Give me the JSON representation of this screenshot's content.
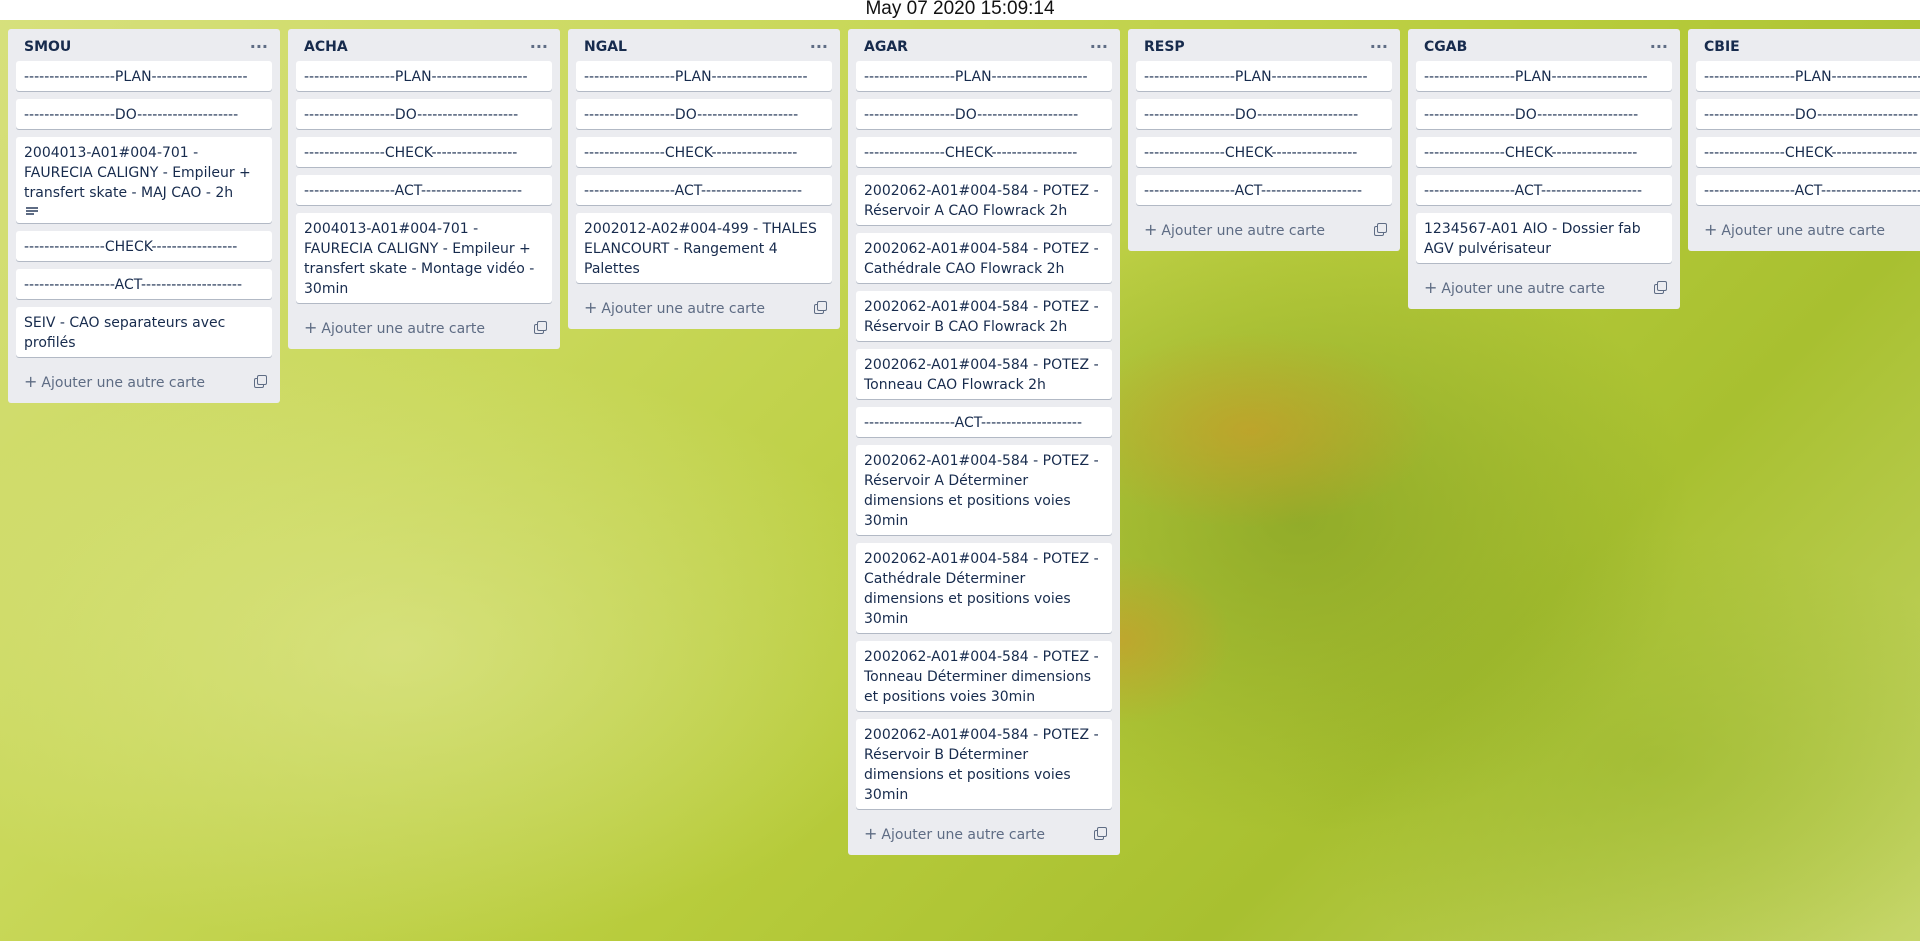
{
  "clock": "May 07 2020 15:09:14",
  "add_card_label": "Ajouter une autre carte",
  "lists": [
    {
      "title": "SMOU",
      "cards": [
        "------------------PLAN-------------------",
        "------------------DO--------------------",
        "2004013-A01#004-701 - FAURECIA CALIGNY - Empileur + transfert skate - MAJ CAO - 2h",
        "----------------CHECK-----------------",
        "------------------ACT--------------------",
        "SEIV - CAO separateurs avec profilés"
      ]
    },
    {
      "title": "ACHA",
      "cards": [
        "------------------PLAN-------------------",
        "------------------DO--------------------",
        "----------------CHECK-----------------",
        "------------------ACT--------------------",
        "2004013-A01#004-701 - FAURECIA CALIGNY - Empileur + transfert skate - Montage vidéo - 30min"
      ]
    },
    {
      "title": "NGAL",
      "cards": [
        "------------------PLAN-------------------",
        "------------------DO--------------------",
        "----------------CHECK-----------------",
        "------------------ACT--------------------",
        "2002012-A02#004-499 - THALES ELANCOURT - Rangement 4 Palettes"
      ]
    },
    {
      "title": "AGAR",
      "cards": [
        "------------------PLAN-------------------",
        "------------------DO--------------------",
        "----------------CHECK-----------------",
        "2002062-A01#004-584 - POTEZ - Réservoir A CAO Flowrack 2h",
        "2002062-A01#004-584 - POTEZ - Cathédrale CAO Flowrack 2h",
        "2002062-A01#004-584 - POTEZ - Réservoir B CAO Flowrack 2h",
        "2002062-A01#004-584 - POTEZ - Tonneau CAO Flowrack 2h",
        "------------------ACT--------------------",
        "2002062-A01#004-584 - POTEZ - Réservoir A Déterminer dimensions et positions voies 30min",
        "2002062-A01#004-584 - POTEZ - Cathédrale Déterminer dimensions et positions voies 30min",
        "2002062-A01#004-584 - POTEZ - Tonneau Déterminer dimensions et positions voies 30min",
        "2002062-A01#004-584 - POTEZ - Réservoir B Déterminer dimensions et positions voies 30min"
      ]
    },
    {
      "title": "RESP",
      "cards": [
        "------------------PLAN-------------------",
        "------------------DO--------------------",
        "----------------CHECK-----------------",
        "------------------ACT--------------------"
      ]
    },
    {
      "title": "CGAB",
      "cards": [
        "------------------PLAN-------------------",
        "------------------DO--------------------",
        "----------------CHECK-----------------",
        "------------------ACT--------------------",
        "1234567-A01 AIO - Dossier fab AGV pulvérisateur"
      ]
    },
    {
      "title": "CBIE",
      "cards": [
        "------------------PLAN-------------------",
        "------------------DO--------------------",
        "----------------CHECK-----------------",
        "------------------ACT--------------------"
      ]
    }
  ]
}
